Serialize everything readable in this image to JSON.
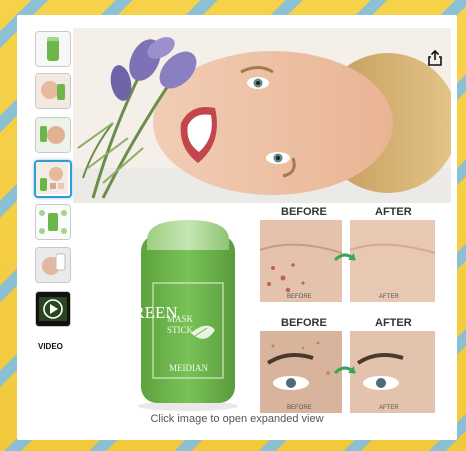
{
  "thumbnails": [
    {
      "name": "thumb-product",
      "selected": false
    },
    {
      "name": "thumb-model",
      "selected": false
    },
    {
      "name": "thumb-before-after",
      "selected": false
    },
    {
      "name": "thumb-lifestyle",
      "selected": true
    },
    {
      "name": "thumb-ingredients",
      "selected": false
    },
    {
      "name": "thumb-application",
      "selected": false
    },
    {
      "name": "thumb-video",
      "selected": false
    }
  ],
  "video_label": "VIDEO",
  "product": {
    "line1": "GREEN",
    "line2": "MASK",
    "line3": "STICK",
    "brand": "MEIDIAN"
  },
  "comparison": {
    "before": "BEFORE",
    "after": "AFTER",
    "photo_before": "BEFORE",
    "photo_after": "AFTER"
  },
  "caption": "Click image to open expanded view",
  "icons": {
    "share": "share-icon",
    "play": "play-icon"
  },
  "colors": {
    "selected_border": "#2f9ed1",
    "product_green": "#6cb64a"
  }
}
